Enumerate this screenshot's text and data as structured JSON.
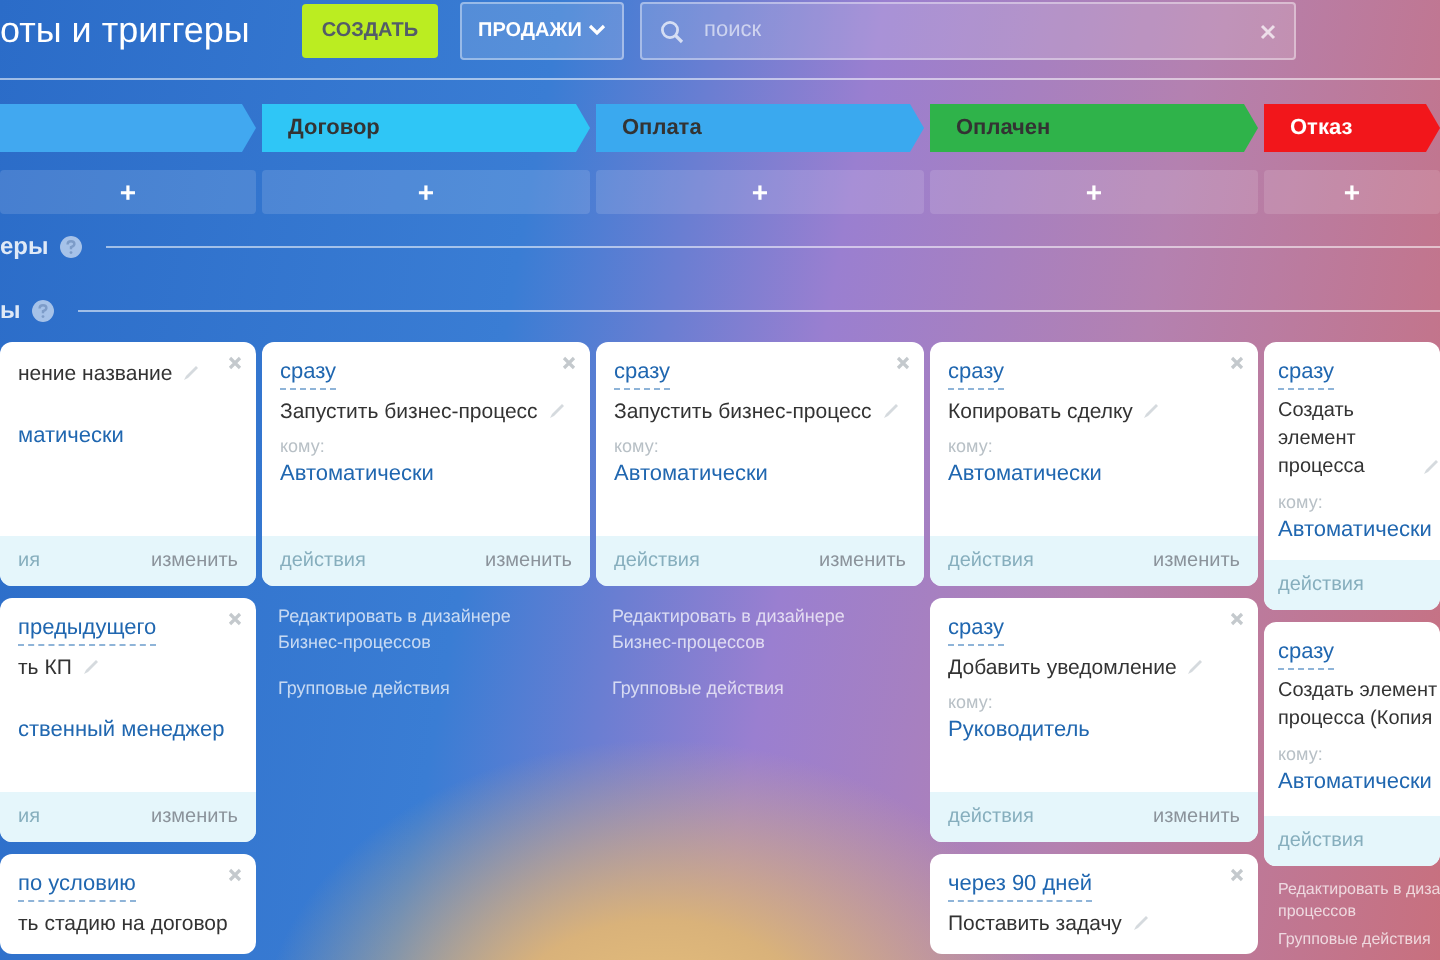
{
  "header": {
    "title": "оты и триггеры",
    "create_button": "СОЗДАТЬ",
    "category_button": "ПРОДАЖИ",
    "search": {
      "placeholder": "поиск"
    }
  },
  "stages": [
    {
      "color": "#41a8f0",
      "add": "+"
    },
    {
      "name": "Договор",
      "color": "#2fc6f6",
      "add": "+"
    },
    {
      "name": "Оплата",
      "color": "#3aa9ef",
      "add": "+"
    },
    {
      "name": "Оплачен",
      "color": "#2fb34a",
      "add": "+"
    },
    {
      "name": "Отказ",
      "color": "#f2161b",
      "add": "+"
    }
  ],
  "sections": [
    {
      "label": "еры"
    },
    {
      "label": "ы"
    }
  ],
  "columns": [
    {
      "cards": [
        {
          "title": "нение название",
          "editable": true,
          "closable": true,
          "assignee": "матически",
          "actions": "ия",
          "change": "изменить"
        },
        {
          "delay": "предыдущего",
          "title": "ть КП",
          "editable": true,
          "closable": true,
          "assignee": "ственный менеджер",
          "actions": "ия",
          "change": "изменить"
        },
        {
          "delay": "по условию",
          "title": "ть стадию на договор",
          "editable": false,
          "closable": true
        }
      ]
    },
    {
      "cards": [
        {
          "delay": "сразу",
          "title": "Запустить бизнес-процесс",
          "editable": true,
          "closable": true,
          "to_label": "кому:",
          "assignee": "Автоматически",
          "actions": "действия",
          "change": "изменить"
        }
      ],
      "links": [
        "Редактировать в дизайнере Бизнес-процессов",
        "Групповые действия"
      ]
    },
    {
      "cards": [
        {
          "delay": "сразу",
          "title": "Запустить бизнес-процесс",
          "editable": true,
          "closable": true,
          "to_label": "кому:",
          "assignee": "Автоматически",
          "actions": "действия",
          "change": "изменить"
        }
      ],
      "links": [
        "Редактировать в дизайнере Бизнес-процессов",
        "Групповые действия"
      ]
    },
    {
      "cards": [
        {
          "delay": "сразу",
          "title": "Копировать сделку",
          "editable": true,
          "closable": true,
          "to_label": "кому:",
          "assignee": "Автоматически",
          "actions": "действия",
          "change": "изменить"
        },
        {
          "delay": "сразу",
          "title": "Добавить уведомление",
          "editable": true,
          "closable": true,
          "to_label": "кому:",
          "assignee": "Руководитель",
          "actions": "действия",
          "change": "изменить"
        },
        {
          "delay": "через 90 дней",
          "title": "Поставить задачу",
          "editable": true,
          "closable": true
        }
      ]
    },
    {
      "cards": [
        {
          "delay": "сразу",
          "title": "Создать элемент\nпроцесса",
          "editable": true,
          "closable": false,
          "to_label": "кому:",
          "assignee": "Автоматически",
          "actions": "действия"
        },
        {
          "delay": "сразу",
          "title": "Создать элемент\nпроцесса (Копия",
          "editable": false,
          "closable": false,
          "to_label": "кому:",
          "assignee": "Автоматически",
          "actions": "действия"
        }
      ],
      "links": [
        "Редактировать в диза\nпроцессов",
        "Групповые действия"
      ]
    }
  ]
}
